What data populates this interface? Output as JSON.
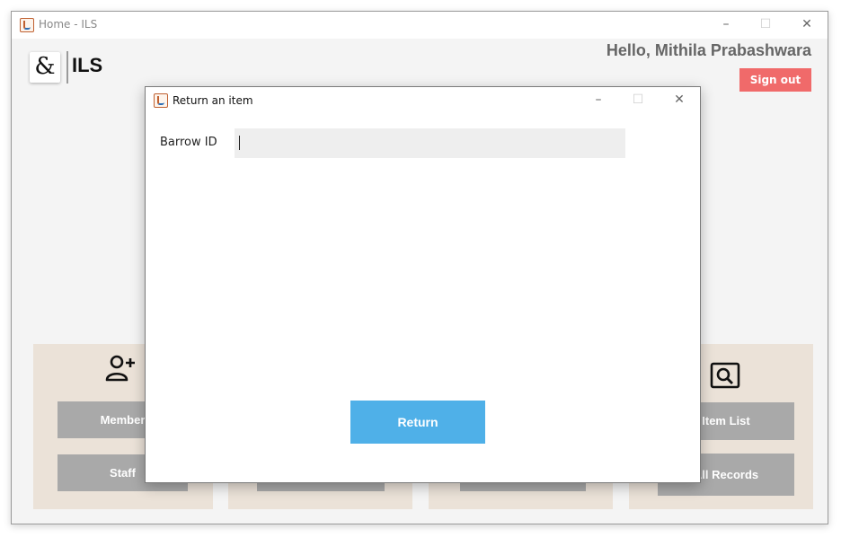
{
  "main_window": {
    "title": "Home - ILS",
    "controls": {
      "minimize": "–",
      "maximize": "☐",
      "close": "✕"
    }
  },
  "header": {
    "logo_glyph": "&",
    "app_name": "ILS",
    "greeting": "Hello, Mithila Prabashwara",
    "sign_out_label": "Sign out"
  },
  "panels": {
    "members": {
      "icon": "add-user-icon",
      "buttons": [
        "Member",
        "Staff"
      ]
    },
    "items": {
      "icon": "search-item-icon",
      "buttons": [
        "Item List",
        "All Records"
      ]
    }
  },
  "dialog": {
    "title": "Return an item",
    "controls": {
      "minimize": "–",
      "maximize": "☐",
      "close": "✕"
    },
    "field_label": "Barrow ID",
    "field_value": "",
    "return_label": "Return"
  },
  "colors": {
    "sign_out": "#f06a6a",
    "return_button": "#4fb0e8",
    "panel_bg": "#ebe2d8",
    "panel_button": "#a9a9a9"
  }
}
